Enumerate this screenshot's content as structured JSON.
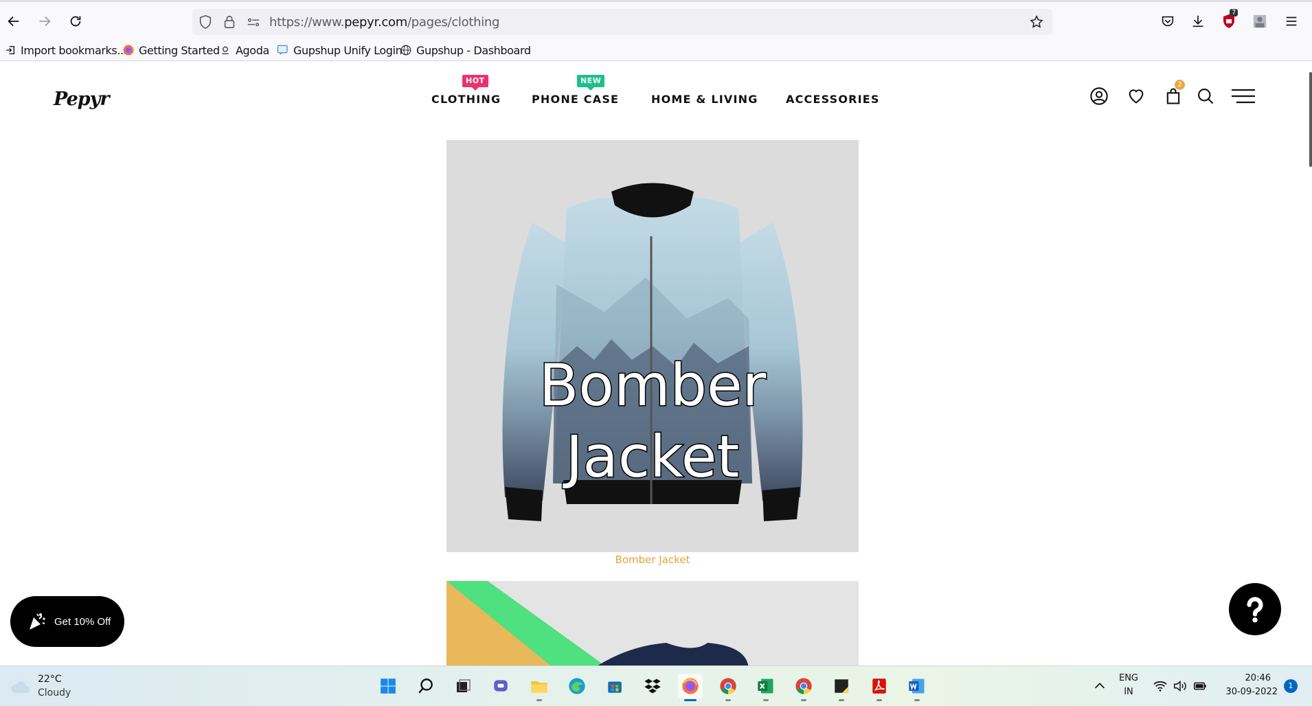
{
  "browser": {
    "url_prefix": "https://www.",
    "url_domain": "pepyr.com",
    "url_path": "/pages/clothing",
    "extension_badge": "7"
  },
  "bookmarks": [
    {
      "label": "Import bookmarks...",
      "icon": "import-icon"
    },
    {
      "label": "Getting Started",
      "icon": "firefox-icon"
    },
    {
      "label": "Agoda",
      "icon": "agoda-icon"
    },
    {
      "label": "Gupshup Unify Login",
      "icon": "gupshup-icon"
    },
    {
      "label": "Gupshup - Dashboard",
      "icon": "globe-icon"
    }
  ],
  "site": {
    "logo": "Pepyr",
    "nav": [
      {
        "label": "CLOTHING",
        "badge": "HOT"
      },
      {
        "label": "PHONE CASE",
        "badge": "NEW"
      },
      {
        "label": "HOME & LIVING",
        "badge": ""
      },
      {
        "label": "ACCESSORIES",
        "badge": ""
      }
    ],
    "cart_count": "2"
  },
  "products": [
    {
      "title_overlay_line1": "Bomber",
      "title_overlay_line2": "Jacket",
      "caption": "Bomber Jacket"
    }
  ],
  "promo": {
    "label": "Get 10% Off"
  },
  "colors": {
    "caption": "#e0a33c",
    "hot_badge": "#e8336d",
    "new_badge": "#1dbf8a",
    "cart_badge": "#e6a94a"
  },
  "taskbar": {
    "weather_temp": "22°C",
    "weather_condition": "Cloudy",
    "language_line1": "ENG",
    "language_line2": "IN",
    "time": "20:46",
    "date": "30-09-2022",
    "notification_count": "1"
  }
}
